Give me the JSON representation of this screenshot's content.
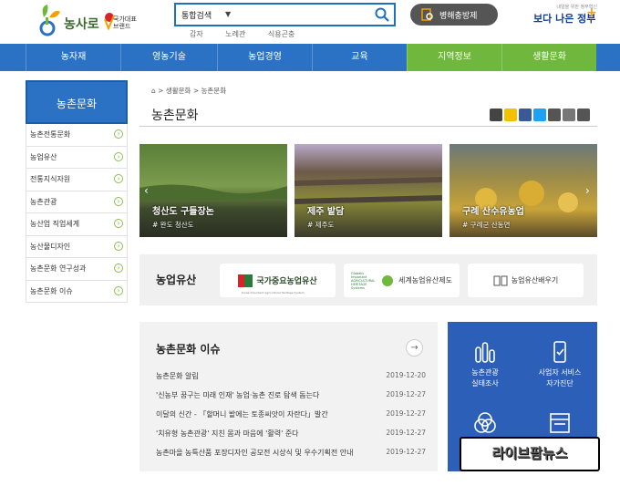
{
  "header": {
    "logo_text": "농사로",
    "logo_badge": "국가대표 브랜드",
    "search_category": "통합검색",
    "search_placeholder": "",
    "keywords": [
      "감자",
      "노례관",
      "식용곤충"
    ],
    "pest_button": "병해충방제",
    "gov_slogan": "내일을 위한 정부혁신",
    "gov_logo": "보다 나은 정부"
  },
  "gnb": [
    "농자재",
    "영농기술",
    "농업경영",
    "교육",
    "지역정보",
    "생활문화"
  ],
  "lnb": {
    "title": "농촌문화",
    "items": [
      "농촌전통문화",
      "농업유산",
      "전통지식자원",
      "농촌관광",
      "농산업 직업세계",
      "농산물디자인",
      "농촌문화 연구성과",
      "농촌문화 이슈"
    ]
  },
  "breadcrumb": [
    "생활문화",
    "농촌문화"
  ],
  "page_title": "농촌문화",
  "slides": [
    {
      "caption": "청산도 구들장논",
      "sub": "# 완도 청산도"
    },
    {
      "caption": "제주 밭담",
      "sub": "# 제주도"
    },
    {
      "caption": "구례 산수유농업",
      "sub": "# 구례군 산동면"
    }
  ],
  "heritage": {
    "title": "농업유산",
    "cards": [
      "국가중요농업유산",
      "세계농업유산제도",
      "농업유산배우기"
    ],
    "giahs_small": "Globally Important AGRICULTURAL HERITAGE Systems",
    "kias_small": "Korea Important Agricultural Heritage System"
  },
  "issue": {
    "title": "농촌문화 이슈",
    "more": "→",
    "rows": [
      {
        "title": "농촌문화 알림",
        "date": "2019-12-20"
      },
      {
        "title": "'신농부 꿈구는 미래 인재' 농업·농촌 진로 탐색 돕는다",
        "date": "2019-12-27"
      },
      {
        "title": "이달의 신간 - 「할머니 밭에는 토종씨앗이 자란다」발간",
        "date": "2019-12-27"
      },
      {
        "title": "'치유형 농촌관광' 지친 몸과 마음에 '활력' 준다",
        "date": "2019-12-27"
      },
      {
        "title": "농촌마을 농특산품 포장디자인 공모전 시상식 및 우수기획전 안내",
        "date": "2019-12-27"
      }
    ]
  },
  "services": [
    {
      "line1": "농촌관광",
      "line2": "실태조사"
    },
    {
      "line1": "사업자 서비스",
      "line2": "자가진단"
    },
    {
      "line1": "",
      "line2": ""
    },
    {
      "line1": "",
      "line2": ""
    }
  ],
  "watermark": "라이브팜뉴스"
}
